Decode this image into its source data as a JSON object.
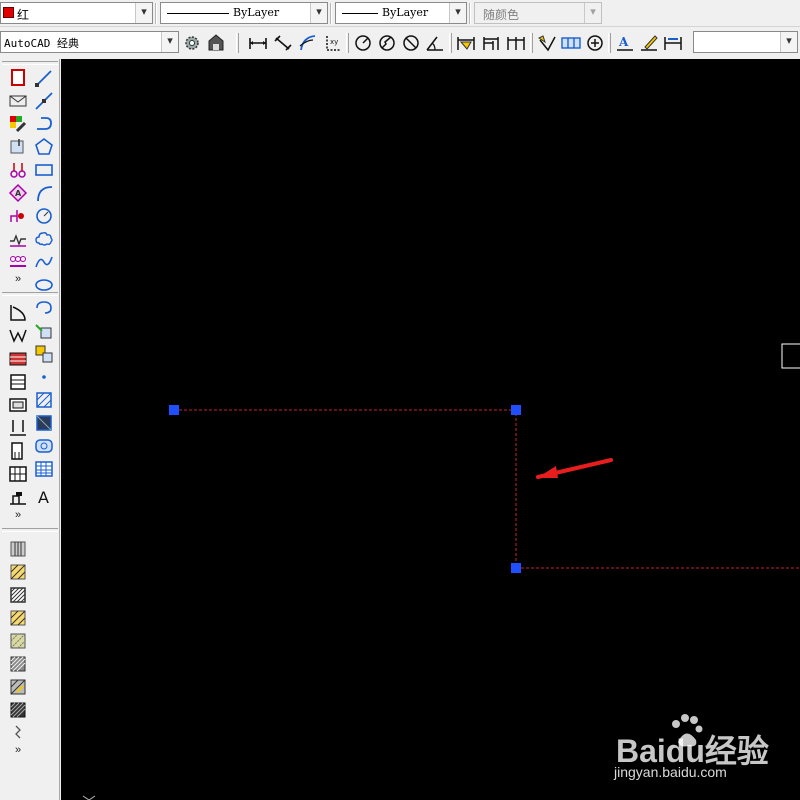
{
  "property_bar": {
    "color_value": "红",
    "linetype_value": "ByLayer",
    "lineweight_value": "ByLayer",
    "plotstyle_value": "随颜色"
  },
  "workspace_toolbar": {
    "workspace_value": "AutoCAD 经典",
    "dimstyle_value": ""
  },
  "colors": {
    "canvas_background": "#000000",
    "dashed_line": "#cc2222",
    "grip": "#1f4fff",
    "arrow": "#e81e1e",
    "color_swatch": "#e00000"
  },
  "left_toolbar": {
    "more_label": "»"
  },
  "watermark": {
    "brand": "Baidu经验",
    "url": "jingyan.baidu.com"
  }
}
